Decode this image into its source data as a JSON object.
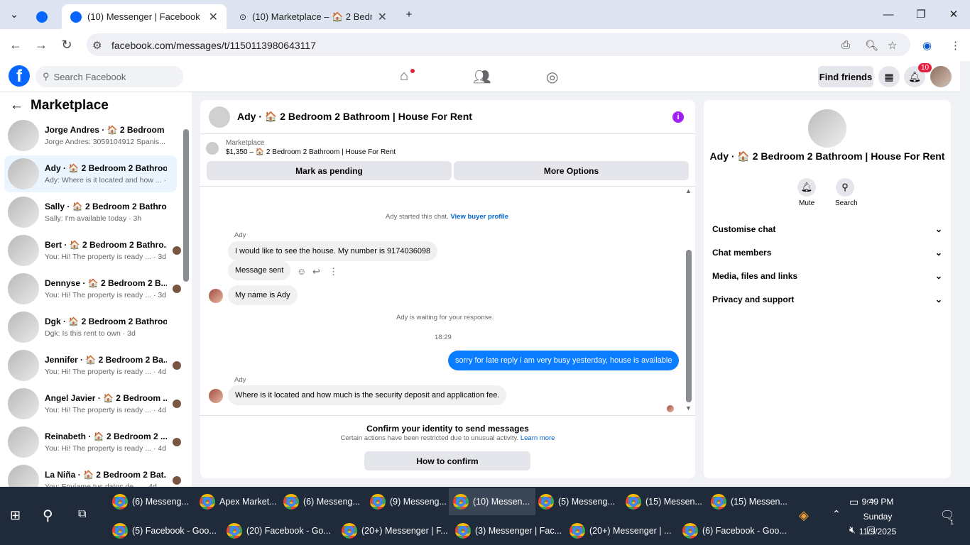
{
  "browser": {
    "tabs": [
      {
        "title": "",
        "icon": "facebook-icon"
      },
      {
        "title": "(10) Messenger | Facebook",
        "icon": "facebook-icon"
      },
      {
        "title": "(10) Marketplace – 🏠 2 Bedroo",
        "icon": "marketplace-icon"
      }
    ],
    "url": "facebook.com/messages/t/1150113980643117"
  },
  "fb": {
    "search_placeholder": "Search Facebook",
    "find_friends": "Find friends",
    "notif_count": "10"
  },
  "sidebar": {
    "title": "Marketplace",
    "conversations": [
      {
        "name": "Jorge Andres · 🏠 2 Bedroom 2 ...",
        "preview": "Jorge Andres: 3059104912 Spanis... · 2h"
      },
      {
        "name": "Ady · 🏠 2 Bedroom 2 Bathroo...",
        "preview": "Ady: Where is it located and how ... · 3h"
      },
      {
        "name": "Sally · 🏠 2 Bedroom 2 Bathroo...",
        "preview": "Sally: I'm available today · 3h"
      },
      {
        "name": "Bert · 🏠 2 Bedroom 2 Bathro...",
        "preview": "You: Hi! The property is ready ... · 3d"
      },
      {
        "name": "Dennyse · 🏠 2 Bedroom 2 B...",
        "preview": "You: Hi! The property is ready ... · 3d"
      },
      {
        "name": "Dgk · 🏠 2 Bedroom 2 Bathroo...",
        "preview": "Dgk: Is this rent to own · 3d"
      },
      {
        "name": "Jennifer · 🏠 2 Bedroom 2 Ba...",
        "preview": "You: Hi! The property is ready ... · 4d"
      },
      {
        "name": "Angel Javier · 🏠 2 Bedroom ...",
        "preview": "You: Hi! The property is ready ... · 4d"
      },
      {
        "name": "Reinabeth · 🏠 2 Bedroom 2 ...",
        "preview": "You: Hi! The property is ready ... · 4d"
      },
      {
        "name": "La Niña · 🏠 2 Bedroom 2 Bat...",
        "preview": "You: Envíame tus datos de ... · 4d"
      }
    ]
  },
  "chat": {
    "header_title": "Ady · 🏠 2 Bedroom 2 Bathroom | House For Rent",
    "marketplace_label": "Marketplace",
    "listing": "$1,350 – 🏠 2 Bedroom 2 Bathroom | House For Rent",
    "mark_pending": "Mark as pending",
    "more_options": "More Options",
    "started_text": "Ady started this chat.",
    "view_buyer_profile": "View buyer profile",
    "sender_name_1": "Ady",
    "msg1": "I would like to see the house. My number is 9174036098",
    "msg2": "Message sent",
    "msg3": "My name is Ady",
    "waiting_text": "Ady is waiting for your response.",
    "time": "18:29",
    "msg_out": "sorry for late reply i am very busy yesterday, house is available",
    "sender_name_2": "Ady",
    "msg4": "Where is it located and how much is the security deposit and application fee.",
    "confirm_title": "Confirm your identity to send messages",
    "confirm_sub": "Certain actions have been restricted due to unusual activity.",
    "learn_more": "Learn more",
    "how_to_confirm": "How to confirm"
  },
  "right_panel": {
    "title": "Ady · 🏠 2 Bedroom 2 Bathroom | House For Rent",
    "mute": "Mute",
    "search": "Search",
    "items": [
      "Customise chat",
      "Chat members",
      "Media, files and links",
      "Privacy and support"
    ]
  },
  "taskbar": {
    "row1": [
      "(6) Messeng...",
      "Apex Market...",
      "(6) Messeng...",
      "(9) Messeng...",
      "(10) Messen...",
      "(5) Messeng...",
      "(15) Messen...",
      "(15) Messen..."
    ],
    "row2": [
      "(5) Facebook - Goo...",
      "(20) Facebook - Go...",
      "(20+) Messenger | F...",
      "(3) Messenger | Fac...",
      "(20+) Messenger | ...",
      "(6) Facebook - Goo..."
    ],
    "time": "9:49 PM",
    "day": "Sunday",
    "date": "11/9/2025",
    "notif_count": "1"
  }
}
